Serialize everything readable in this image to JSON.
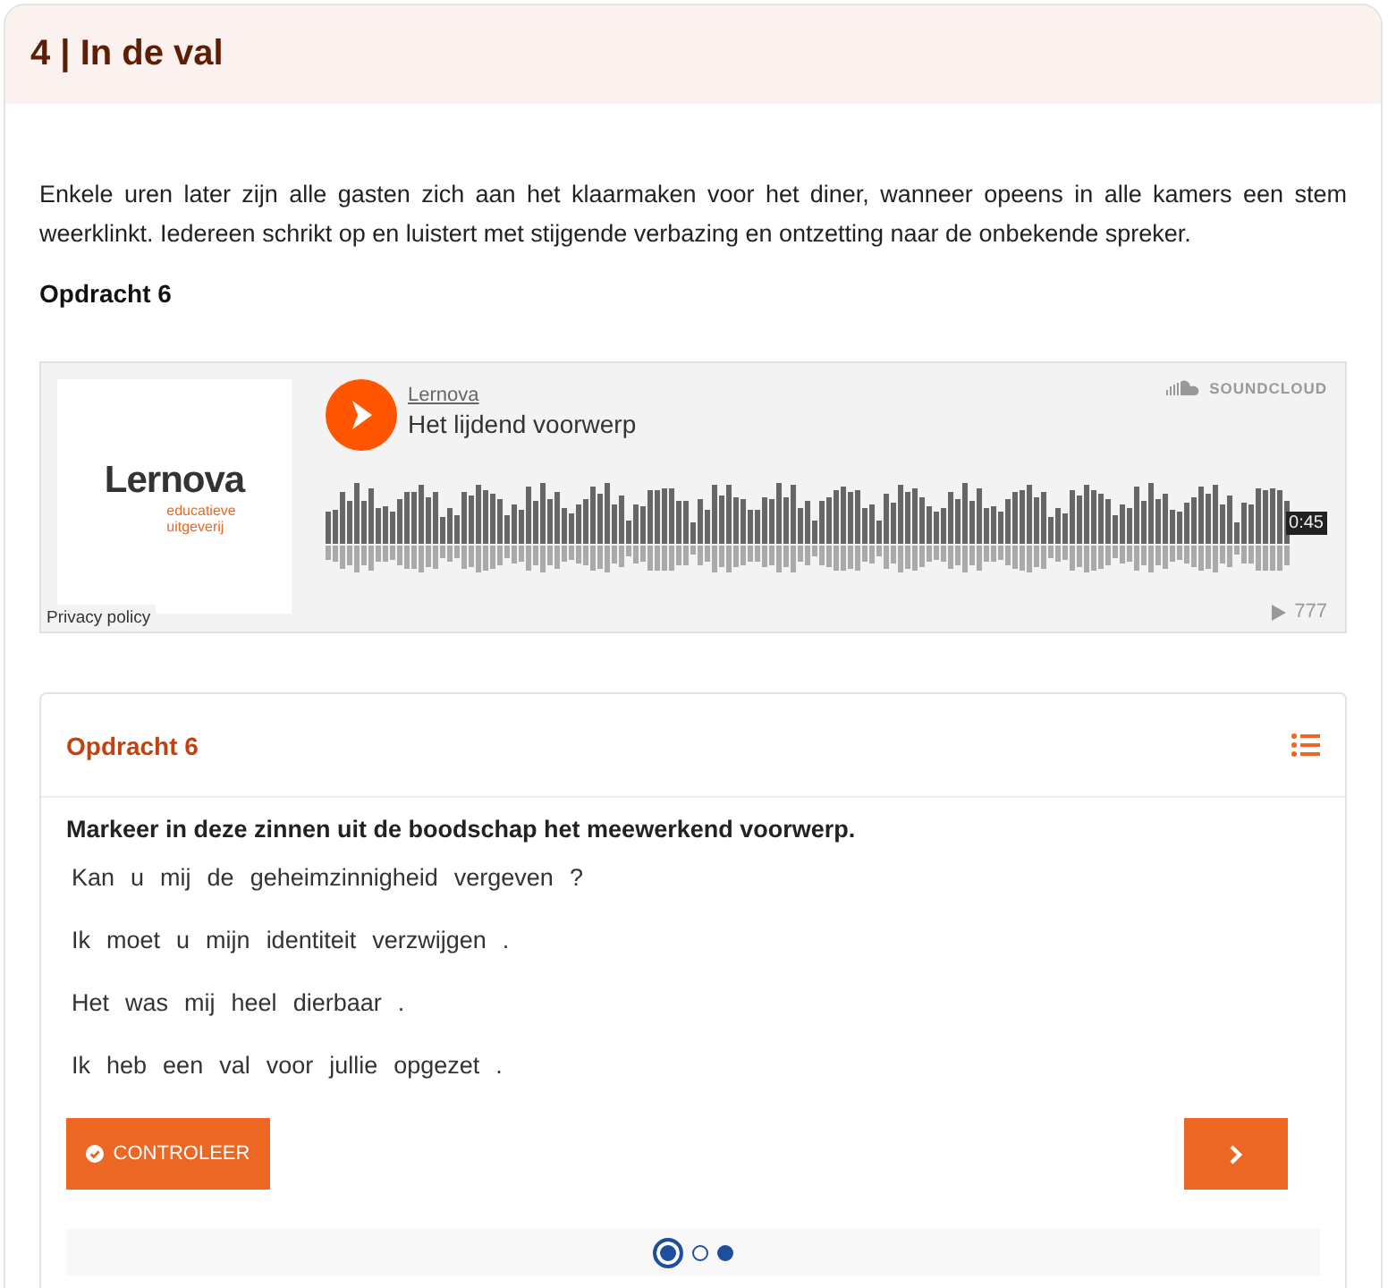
{
  "section": {
    "title": "4 | In de val"
  },
  "intro": "Enkele uren later zijn alle gasten zich aan het klaarmaken voor het diner, wanneer opeens in alle kamers een stem weerklinkt. Iedereen schrikt op en luistert met stijgende verbazing en ontzetting naar de onbekende spreker.",
  "assignment_label": "Opdracht 6",
  "player": {
    "logo_name": "Lernova",
    "logo_tagline": [
      "educatieve",
      "uitgeverij"
    ],
    "privacy": "Privacy policy",
    "artist": "Lernova",
    "track": "Het lijdend voorwerp",
    "brand": "SOUNDCLOUD",
    "duration": "0:45",
    "plays": "777"
  },
  "exercise": {
    "title": "Opdracht 6",
    "instruction": "Markeer in deze zinnen uit de boodschap het meewerkend voorwerp.",
    "sentences": [
      [
        "Kan",
        "u",
        "mij",
        "de",
        "geheimzinnigheid",
        "vergeven",
        "?"
      ],
      [
        "Ik",
        "moet",
        "u",
        "mijn",
        "identiteit",
        "verzwijgen",
        "."
      ],
      [
        "Het",
        "was",
        "mij",
        "heel",
        "dierbaar",
        "."
      ],
      [
        "Ik",
        "heb",
        "een",
        "val",
        "voor",
        "jullie",
        "opgezet",
        "."
      ]
    ],
    "check_button": "CONTROLEER",
    "pages": [
      {
        "selected": true,
        "filled": true
      },
      {
        "selected": false,
        "filled": false
      },
      {
        "selected": false,
        "filled": true
      }
    ]
  }
}
